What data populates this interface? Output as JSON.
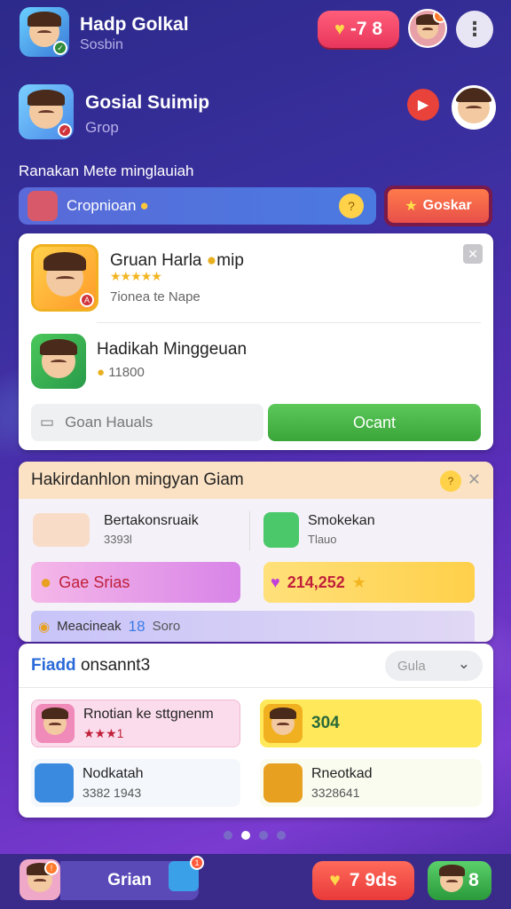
{
  "topbar": {
    "title": "Hadp Golkal",
    "subtitle": "Sosbin",
    "gem_value": "-7 8"
  },
  "group": {
    "title": "Gosial Suimip",
    "subtitle": "Grop"
  },
  "section_label": "Ranakan Mete minglauiah",
  "search": {
    "text": "Cropnioan"
  },
  "go_button": {
    "label": "Goskar"
  },
  "card1": {
    "item1": {
      "title": "Gruan Harla",
      "title_suffix": "mip",
      "stars": "★★★★★",
      "subtitle": "7ionea te Nape"
    },
    "item2": {
      "title": "Hadikah Minggeuan",
      "subtitle": "11800"
    },
    "left_button": "Goan Hauals",
    "right_button": "Ocant"
  },
  "card2": {
    "header": "Hakirdanhlon mingyan Giam",
    "tile1": {
      "name": "Bertakonsruaik",
      "sub": "3393l"
    },
    "tile2": {
      "name": "Smokekan",
      "sub": "Tlauo"
    },
    "pill1": {
      "label": "Gae Srias"
    },
    "pill2": {
      "value": "214,252"
    },
    "strip": {
      "label": "Meacineak",
      "number": "18",
      "suffix": "Soro"
    }
  },
  "card3": {
    "title_accent": "Fiadd",
    "title_rest": "onsannt3",
    "select": "Gula",
    "items": [
      {
        "name": "Rnotian ke sttgnenm",
        "sub": "★★★1"
      },
      {
        "value": "304"
      },
      {
        "name": "Nodkatah",
        "sub": "3382 1943"
      },
      {
        "name": "Rneotkad",
        "sub": "3328641"
      }
    ]
  },
  "bottombar": {
    "tab_label": "Grian",
    "gem_value": "7 9ds",
    "friends_value": "8"
  },
  "colors": {
    "accent_green": "#3aa63a",
    "accent_red": "#e8365c",
    "background": "#3b2fa0"
  }
}
